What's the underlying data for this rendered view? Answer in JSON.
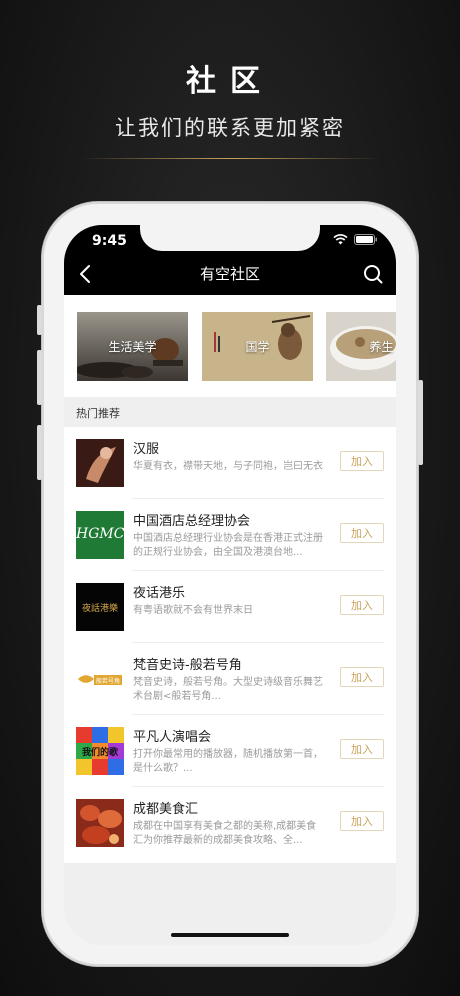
{
  "promo": {
    "title": "社区",
    "subtitle": "让我们的联系更加紧密"
  },
  "status_bar": {
    "time": "9:45",
    "icons": [
      "signal-icon",
      "wifi-icon",
      "battery-icon"
    ]
  },
  "nav": {
    "title": "有空社区",
    "back_icon": "chevron-left-icon",
    "search_icon": "search-icon"
  },
  "categories": [
    {
      "label": "生活美学"
    },
    {
      "label": "国学"
    },
    {
      "label": "养生"
    }
  ],
  "section": {
    "title": "热门推荐"
  },
  "items": [
    {
      "title": "汉服",
      "desc": "华夏有衣，襟带天地，与子同袍，岂曰无衣",
      "join": "加入"
    },
    {
      "title": "中国酒店总经理协会",
      "desc": "中国酒店总经理行业协会是在香港正式注册的正规行业协会，由全国及港澳台地...",
      "join": "加入",
      "thumb_text": "HGMC"
    },
    {
      "title": "夜话港乐",
      "desc": "有粤语歌就不会有世界末日",
      "join": "加入",
      "thumb_text": "夜話港樂"
    },
    {
      "title": "梵音史诗-般若号角",
      "desc": "梵音史诗，般若号角。大型史诗级音乐舞艺术台剧<般若号角...",
      "join": "加入",
      "thumb_text": "般若号角"
    },
    {
      "title": "平凡人演唱会",
      "desc": "打开你最常用的播放器，随机播放第一首，是什么歌？...",
      "join": "加入",
      "thumb_text": "我们的歌"
    },
    {
      "title": "成都美食汇",
      "desc": "成都在中国享有美食之都的美称,成都美食汇为你推荐最新的成都美食攻略、全...",
      "join": "加入"
    }
  ],
  "colors": {
    "accent_gold": "#c9a35a",
    "nav_bg": "#000000",
    "hgmc_green": "#1f7a35"
  }
}
